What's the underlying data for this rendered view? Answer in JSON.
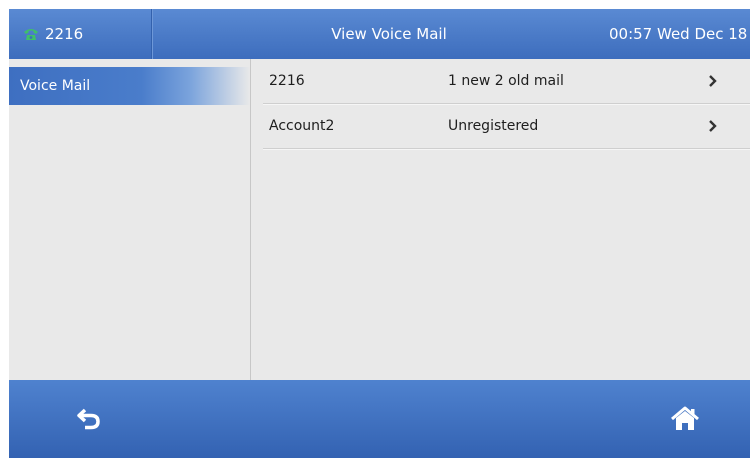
{
  "header": {
    "account_label": "2216",
    "title": "View Voice Mail",
    "clock": "00:57 Wed Dec 18"
  },
  "sidebar": {
    "items": [
      {
        "label": "Voice Mail"
      }
    ]
  },
  "accounts": [
    {
      "name": "2216",
      "status": "1 new 2 old mail"
    },
    {
      "name": "Account2",
      "status": "Unregistered"
    }
  ],
  "icons": {
    "phone": "phone-icon",
    "chevron": "chevron-right-icon",
    "back": "back-icon",
    "home": "home-icon"
  },
  "colors": {
    "bar_blue": "#3d6dbd",
    "phone_green": "#3fbf6a",
    "panel_gray": "#e9e9e9"
  }
}
